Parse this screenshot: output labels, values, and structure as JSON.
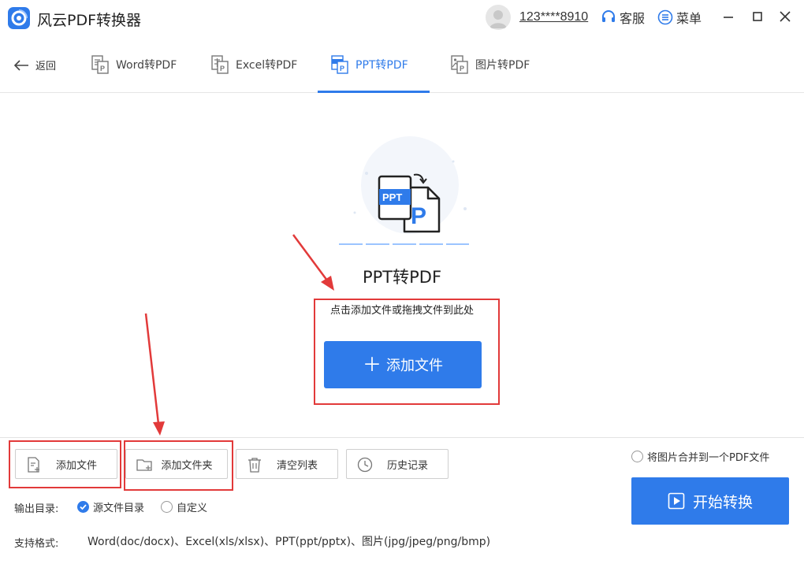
{
  "titlebar": {
    "app_title": "风云PDF转换器",
    "user_phone": "123****8910",
    "service_label": "客服",
    "menu_label": "菜单"
  },
  "nav": {
    "back_label": "返回",
    "tabs": [
      {
        "label": "Word转PDF",
        "active": false
      },
      {
        "label": "Excel转PDF",
        "active": false
      },
      {
        "label": "PPT转PDF",
        "active": true
      },
      {
        "label": "图片转PDF",
        "active": false
      }
    ]
  },
  "main": {
    "title": "PPT转PDF",
    "hint": "点击添加文件或拖拽文件到此处",
    "add_file_label": "添加文件",
    "icon_front_text": "PPT",
    "icon_back_text": "P"
  },
  "toolbar": {
    "add_file": "添加文件",
    "add_folder": "添加文件夹",
    "clear_list": "清空列表",
    "history": "历史记录"
  },
  "output": {
    "label": "输出目录:",
    "options": [
      {
        "label": "源文件目录",
        "checked": true
      },
      {
        "label": "自定义",
        "checked": false
      }
    ]
  },
  "formats": {
    "label": "支持格式:",
    "value": "Word(doc/docx)、Excel(xls/xlsx)、PPT(ppt/pptx)、图片(jpg/jpeg/png/bmp)"
  },
  "merge_label": "将图片合并到一个PDF文件",
  "start_label": "开始转换",
  "colors": {
    "accent": "#2f7bea",
    "annotation_red": "#e23a3a"
  },
  "icons": {
    "close": "close-icon",
    "minimize": "minimize-icon",
    "maximize": "maximize-icon",
    "back": "arrow-left-icon",
    "service": "headset-icon",
    "menu": "list-icon",
    "play": "play-icon"
  }
}
